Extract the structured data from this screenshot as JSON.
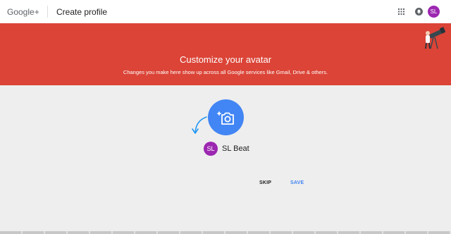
{
  "header": {
    "logo": "Google+",
    "page_title": "Create profile",
    "icons": [
      "apps-grid-icon",
      "notifications-icon"
    ],
    "avatar_initials": "SL"
  },
  "banner": {
    "title": "Customize your avatar",
    "subtitle": "Changes you make here show up across all Google services like Gmail, Drive & others."
  },
  "profile": {
    "initials": "SL",
    "name": "SL Beat"
  },
  "actions": {
    "skip_label": "SKIP",
    "save_label": "SAVE"
  },
  "colors": {
    "banner": "#db4437",
    "accent": "#4285f4",
    "avatar": "#9c27b0",
    "background": "#eeeeee"
  }
}
